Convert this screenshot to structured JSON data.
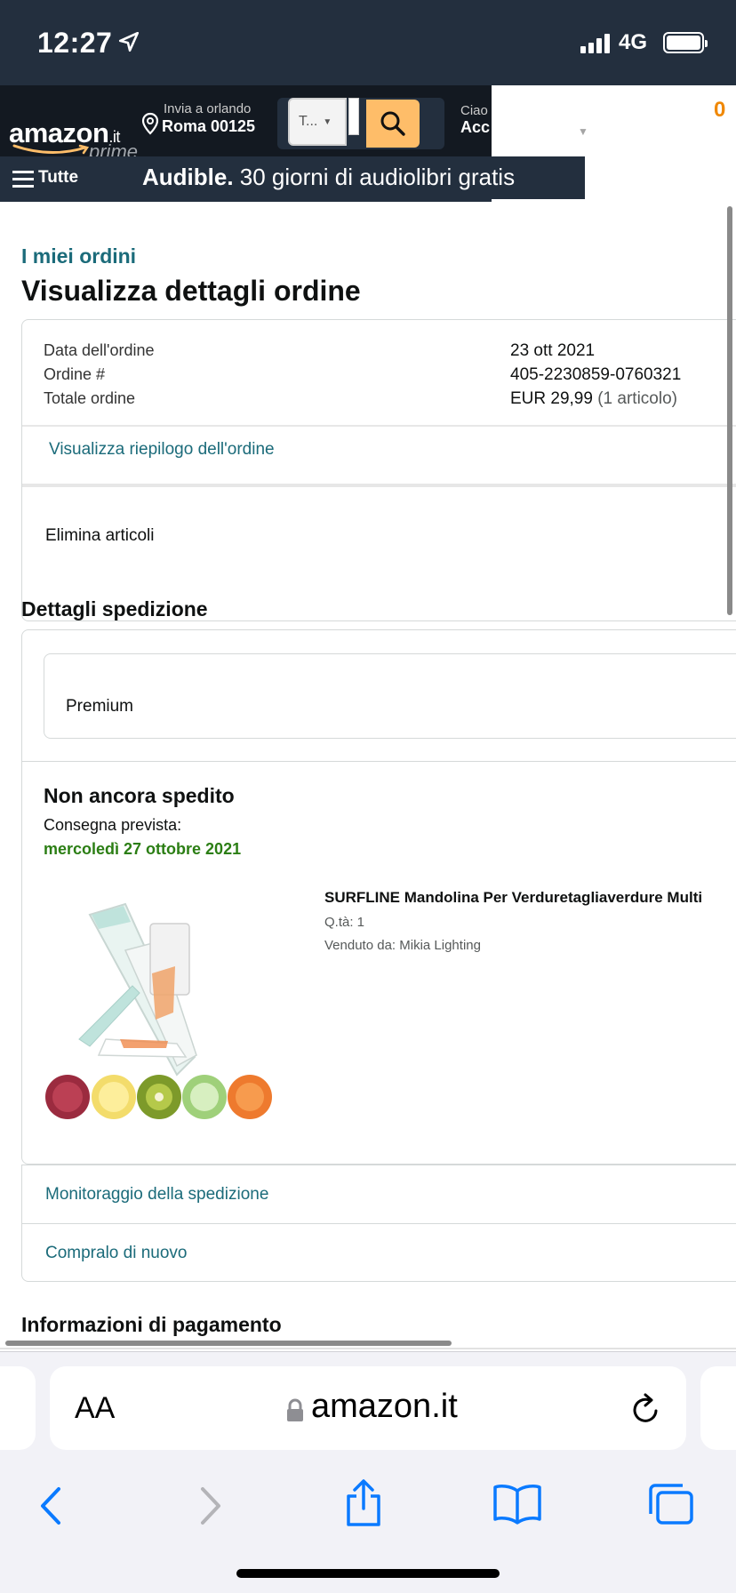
{
  "status_bar": {
    "time": "12:27",
    "network": "4G"
  },
  "header": {
    "logo_text": "amazon",
    "logo_tld": ".it",
    "prime_label": "prime",
    "deliver_to": "Invia a orlando",
    "deliver_address": "Roma 00125",
    "search_dept": "T...",
    "greeting": "Ciao",
    "account_label": "Acc",
    "cart_count": "0",
    "menu_label": "Tutte",
    "promo_brand": "Audible.",
    "promo_text": " 30 giorni di audiolibri gratis"
  },
  "page": {
    "breadcrumb": "I miei ordini",
    "title": "Visualizza dettagli ordine"
  },
  "order_summary": {
    "rows": [
      {
        "label": "Data dell'ordine",
        "value": "23 ott 2021"
      },
      {
        "label": "Ordine #",
        "value": "405-2230859-0760321"
      },
      {
        "label": "Totale ordine",
        "value": "EUR 29,99",
        "value_note": "(1 articolo)"
      }
    ],
    "view_summary_link": "Visualizza riepilogo dell'ordine",
    "delete_items": "Elimina articoli"
  },
  "shipping": {
    "section_title": "Dettagli spedizione",
    "shipping_option": "Premium",
    "status": "Non ancora spedito",
    "delivery_label": "Consegna prevista:",
    "delivery_date": "mercoledì 27 ottobre 2021",
    "product": {
      "name": "SURFLINE Mandolina Per Verduretagliaverdure Multi",
      "qty": "Q.tà: 1",
      "seller": "Venduto da: Mikia Lighting"
    },
    "actions": [
      {
        "label": "Monitoraggio della spedizione"
      },
      {
        "label": "Compralo di nuovo"
      }
    ]
  },
  "payment": {
    "section_title": "Informazioni di pagamento"
  },
  "browser": {
    "text_size_label": "AA",
    "url": "amazon.it"
  },
  "colors": {
    "header_dark": "#131921",
    "header_secondary": "#232f3e",
    "link": "#1b6b7a",
    "delivery_green": "#2b7e14",
    "search_button": "#febd69",
    "cart_orange": "#f08804"
  }
}
